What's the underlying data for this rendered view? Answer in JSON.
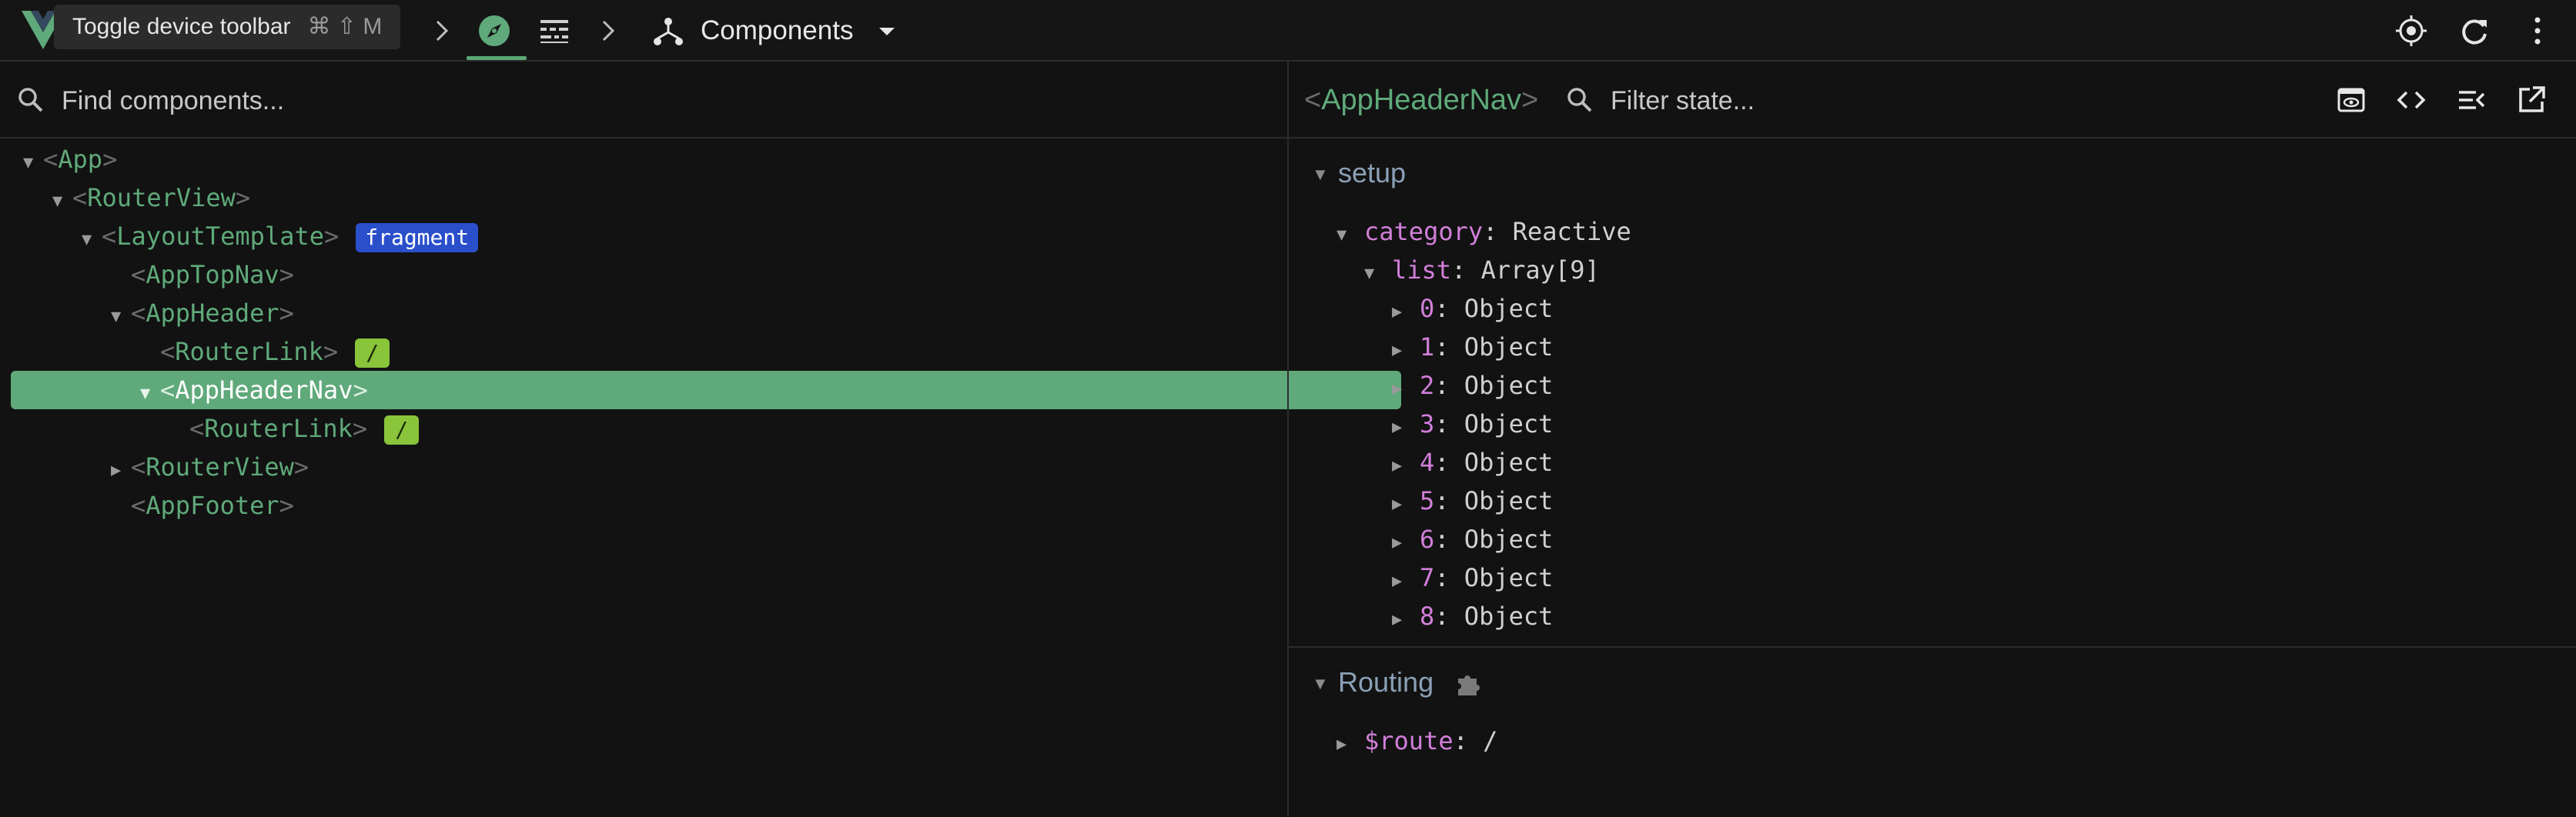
{
  "tooltip": {
    "text": "Toggle device toolbar",
    "shortcut": "⌘ ⇧ M"
  },
  "topbar": {
    "tab_label": "Components"
  },
  "component_search": {
    "placeholder": "Find components..."
  },
  "tree": [
    {
      "name": "App",
      "expanded": true
    },
    {
      "name": "RouterView",
      "expanded": true
    },
    {
      "name": "LayoutTemplate",
      "expanded": true,
      "badge": "fragment"
    },
    {
      "name": "AppTopNav"
    },
    {
      "name": "AppHeader",
      "expanded": true
    },
    {
      "name": "RouterLink",
      "badge": "/"
    },
    {
      "name": "AppHeaderNav",
      "expanded": true,
      "selected": true
    },
    {
      "name": "RouterLink",
      "badge": "/"
    },
    {
      "name": "RouterView",
      "expanded": false
    },
    {
      "name": "AppFooter"
    }
  ],
  "inspector": {
    "component": "AppHeaderNav",
    "filter_placeholder": "Filter state...",
    "setup": {
      "title": "setup",
      "category_key": "category",
      "category_value": "Reactive",
      "list_key": "list",
      "list_value": "Array[9]",
      "items": [
        {
          "key": "0",
          "value": "Object"
        },
        {
          "key": "1",
          "value": "Object"
        },
        {
          "key": "2",
          "value": "Object"
        },
        {
          "key": "3",
          "value": "Object"
        },
        {
          "key": "4",
          "value": "Object"
        },
        {
          "key": "5",
          "value": "Object"
        },
        {
          "key": "6",
          "value": "Object"
        },
        {
          "key": "7",
          "value": "Object"
        },
        {
          "key": "8",
          "value": "Object"
        }
      ]
    },
    "routing": {
      "title": "Routing",
      "route_key": "$route",
      "route_value": "/"
    }
  },
  "colors": {
    "accent": "#5fa97a",
    "state_key": "#d17fd9",
    "fragment_badge": "#2a4fcb",
    "route_badge": "#8ac43b"
  }
}
